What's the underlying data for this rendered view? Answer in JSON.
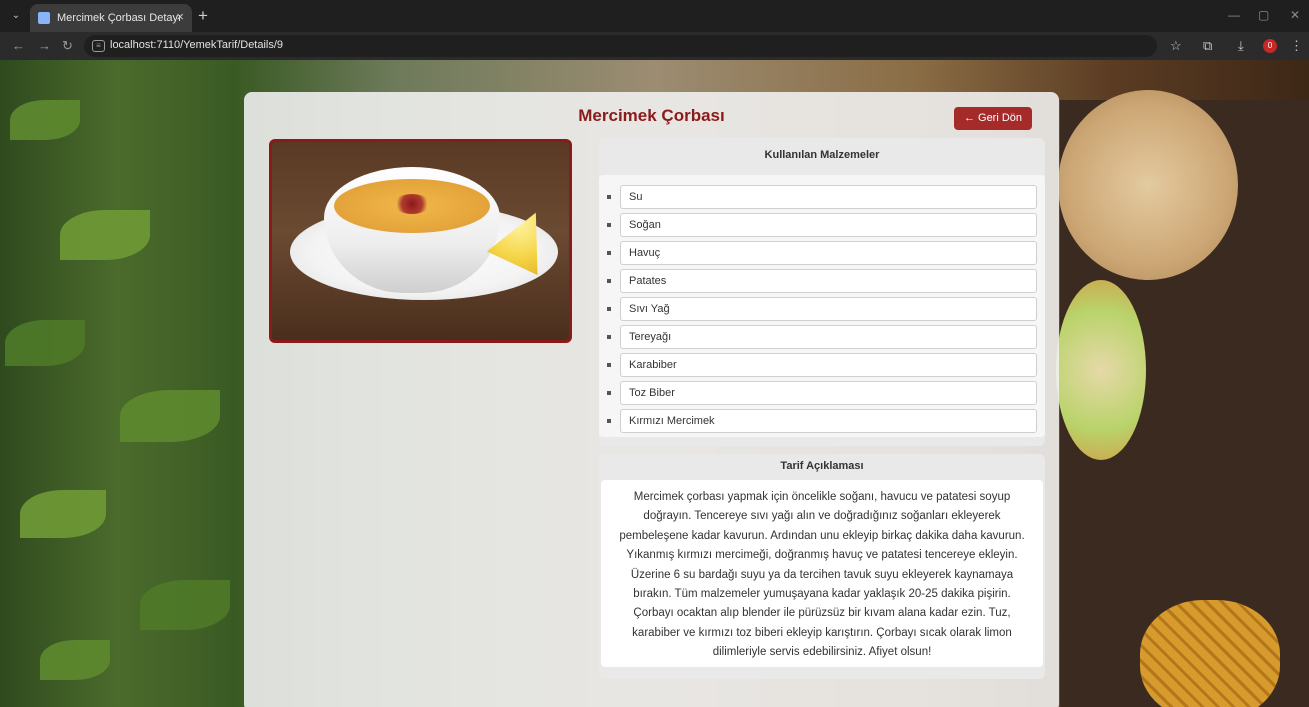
{
  "browser": {
    "tab_title": "Mercimek Çorbası Detayı",
    "url": "localhost:7110/YemekTarif/Details/9",
    "extension_badge": "0"
  },
  "page": {
    "title": "Mercimek Çorbası",
    "back_label": "← Geri Dön",
    "image_alt": "Mercimek Çorbası"
  },
  "ingredients": {
    "heading": "Kullanılan Malzemeler",
    "items": [
      "Su",
      "Soğan",
      "Havuç",
      "Patates",
      "Sıvı Yağ",
      "Tereyağı",
      "Karabiber",
      "Toz Biber",
      "Kırmızı Mercimek"
    ]
  },
  "recipe": {
    "heading": "Tarif Açıklaması",
    "text": "Mercimek çorbası yapmak için öncelikle soğanı, havucu ve patatesi soyup doğrayın. Tencereye sıvı yağı alın ve doğradığınız soğanları ekleyerek pembeleşene kadar kavurun. Ardından unu ekleyip birkaç dakika daha kavurun. Yıkanmış kırmızı mercimeği, doğranmış havuç ve patatesi tencereye ekleyin. Üzerine 6 su bardağı suyu ya da tercihen tavuk suyu ekleyerek kaynamaya bırakın. Tüm malzemeler yumuşayana kadar yaklaşık 20-25 dakika pişirin. Çorbayı ocaktan alıp blender ile pürüzsüz bir kıvam alana kadar ezin. Tuz, karabiber ve kırmızı toz biberi ekleyip karıştırın. Çorbayı sıcak olarak limon dilimleriyle servis edebilirsiniz. Afiyet olsun!"
  },
  "colors": {
    "accent": "#8b1a1a",
    "button": "#a52a2a"
  }
}
